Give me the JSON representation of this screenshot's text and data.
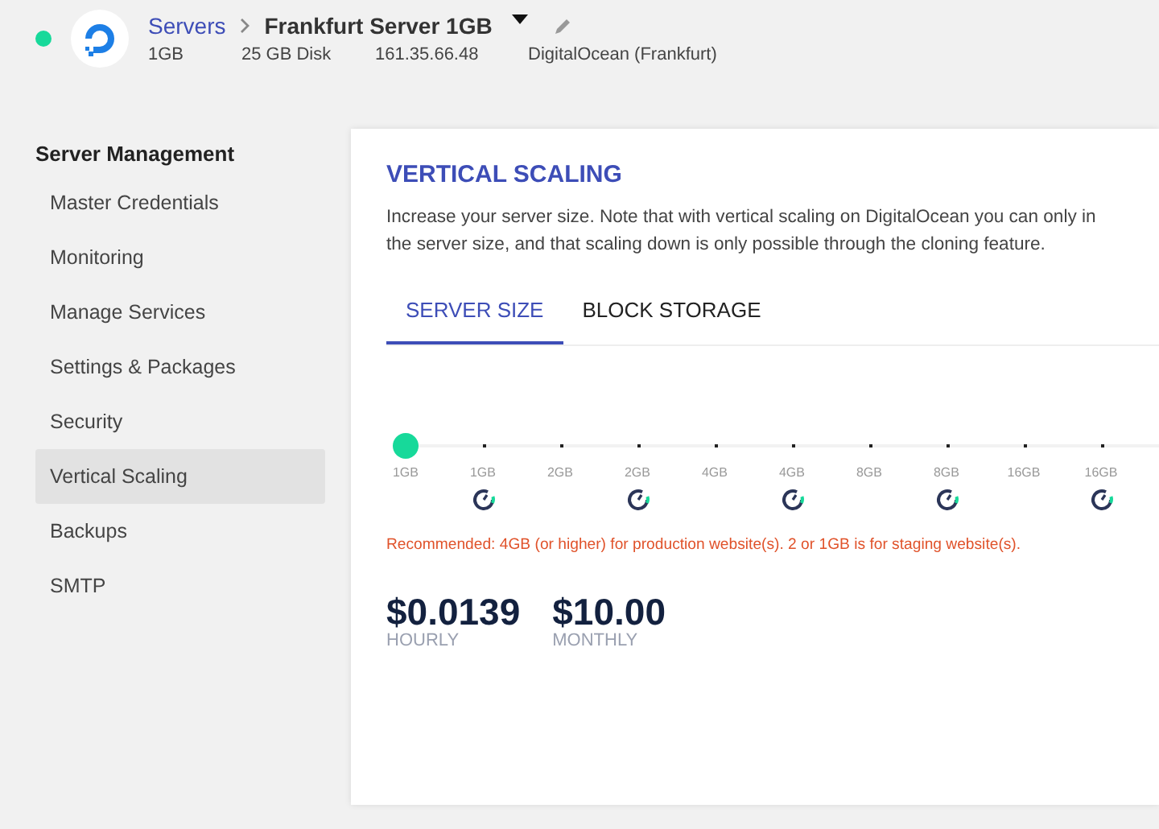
{
  "header": {
    "online": true,
    "breadcrumb": "Servers",
    "server_name": "Frankfurt Server 1GB",
    "specs": [
      "1GB",
      "25 GB Disk",
      "161.35.66.48",
      "DigitalOcean (Frankfurt)"
    ]
  },
  "sidebar": {
    "title": "Server Management",
    "items": [
      {
        "label": "Master Credentials",
        "selected": false
      },
      {
        "label": "Monitoring",
        "selected": false
      },
      {
        "label": "Manage Services",
        "selected": false
      },
      {
        "label": "Settings & Packages",
        "selected": false
      },
      {
        "label": "Security",
        "selected": false
      },
      {
        "label": "Vertical Scaling",
        "selected": true
      },
      {
        "label": "Backups",
        "selected": false
      },
      {
        "label": "SMTP",
        "selected": false
      }
    ]
  },
  "panel": {
    "title": "VERTICAL SCALING",
    "description": [
      "Increase your server size. Note that with vertical scaling on DigitalOcean you can only in",
      "the server size, and that scaling down is only possible through the cloning feature."
    ],
    "tabs": [
      {
        "label": "SERVER SIZE",
        "selected": true
      },
      {
        "label": "BLOCK STORAGE",
        "selected": false
      }
    ],
    "slider": {
      "level": 0,
      "stops": [
        {
          "label": "1GB",
          "icon": false
        },
        {
          "label": "1GB",
          "icon": true
        },
        {
          "label": "2GB",
          "icon": false
        },
        {
          "label": "2GB",
          "icon": true
        },
        {
          "label": "4GB",
          "icon": false
        },
        {
          "label": "4GB",
          "icon": true
        },
        {
          "label": "8GB",
          "icon": false
        },
        {
          "label": "8GB",
          "icon": true
        },
        {
          "label": "16GB",
          "icon": false
        },
        {
          "label": "16GB",
          "icon": true
        }
      ]
    },
    "note": "Recommended: 4GB (or higher) for production website(s). 2 or 1GB is for staging website(s).",
    "prices": [
      {
        "amount": "$0.0139",
        "period": "HOURLY"
      },
      {
        "amount": "$10.00",
        "period": "MONTHLY"
      }
    ]
  }
}
